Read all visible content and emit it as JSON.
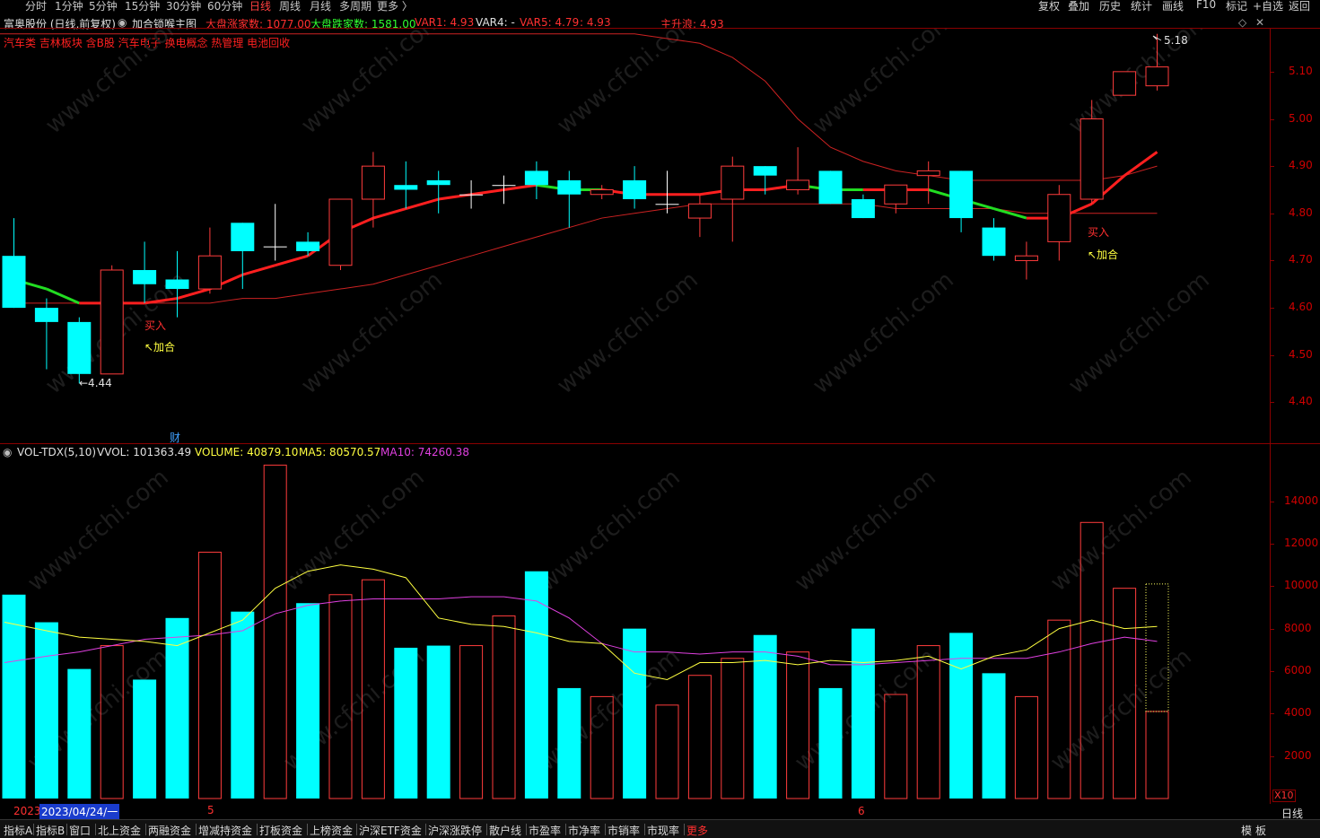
{
  "periods": [
    "分时",
    "1分钟",
    "5分钟",
    "15分钟",
    "30分钟",
    "60分钟",
    "日线",
    "周线",
    "月线",
    "多周期",
    "更多 〉"
  ],
  "active_period": "日线",
  "tools": [
    "复权",
    "叠加",
    "历史",
    "统计",
    "画线",
    "F10",
    "标记",
    "+自选",
    "返回"
  ],
  "stock_title": "富奥股份 (日线,前复权)",
  "indicator_name": "加合锁喉主图",
  "market_up": "大盘涨家数: 1077.00",
  "market_down": "大盘跌家数: 1581.00",
  "var1": "VAR1: 4.93",
  "var4": "VAR4: -",
  "var5": "VAR5: 4.79",
  "var_extra": ": 4.93",
  "main_rise": "主升浪: 4.93",
  "concepts": "汽车类 吉林板块 含B股 汽车电子 换电概念 热管理 电池回收",
  "price_ticks": [
    "5.10",
    "5.00",
    "4.90",
    "4.80",
    "4.70",
    "4.60",
    "4.50",
    "4.40"
  ],
  "vol_ticks": [
    "14000",
    "12000",
    "10000",
    "8000",
    "6000",
    "4000",
    "2000"
  ],
  "vol_indicator": {
    "name": "VOL-TDX(5,10)",
    "vvol": "VVOL: 101363.49",
    "volume": "VOLUME: 40879.10",
    "ma5": "MA5: 80570.57",
    "ma10": "MA10: 74260.38"
  },
  "vol_unit_label": "X10",
  "annotations": {
    "buy": "买入",
    "add": "↖加合",
    "low_price": "←4.44",
    "high_price": "5.18",
    "finance_mark": "财"
  },
  "date_labels": {
    "year": "2023",
    "current": "2023/04/24/一",
    "m5": "5",
    "m6": "6"
  },
  "bottom_tabs": [
    "指标A",
    "指标B",
    "窗口",
    "北上资金",
    "两融资金",
    "增减持资金",
    "打板资金",
    "上榜资金",
    "沪深ETF资金",
    "沪深涨跌停",
    "散户线",
    "市盈率",
    "市净率",
    "市销率",
    "市现率",
    "更多"
  ],
  "active_tab": "更多",
  "right_bottom": [
    "模",
    "板",
    "日线"
  ],
  "colors": {
    "up": "#ff3c3c",
    "down": "#00ffff",
    "flat": "#ffffff",
    "frame": "#8b0000",
    "ma_red": "#ff1f1f",
    "ma_green": "#22dd22",
    "ma_slow": "#cc2222",
    "vol_ma5": "#ffff40",
    "vol_ma10": "#e040e0",
    "buy_text": "#ff3030",
    "add_text": "#ffff40"
  },
  "chart_data": [
    {
      "type": "candlestick",
      "title": "富奥股份 (日线,前复权)",
      "ylim": [
        4.32,
        5.2
      ],
      "yticks": [
        4.4,
        4.5,
        4.6,
        4.7,
        4.8,
        4.9,
        5.0,
        5.1
      ],
      "candles": [
        {
          "o": 4.71,
          "h": 4.79,
          "l": 4.6,
          "c": 4.6
        },
        {
          "o": 4.6,
          "h": 4.62,
          "l": 4.47,
          "c": 4.57
        },
        {
          "o": 4.57,
          "h": 4.58,
          "l": 4.44,
          "c": 4.46
        },
        {
          "o": 4.46,
          "h": 4.69,
          "l": 4.46,
          "c": 4.68
        },
        {
          "o": 4.68,
          "h": 4.74,
          "l": 4.61,
          "c": 4.65
        },
        {
          "o": 4.66,
          "h": 4.72,
          "l": 4.58,
          "c": 4.64
        },
        {
          "o": 4.64,
          "h": 4.77,
          "l": 4.63,
          "c": 4.71
        },
        {
          "o": 4.78,
          "h": 4.78,
          "l": 4.64,
          "c": 4.72
        },
        {
          "o": 4.73,
          "h": 4.82,
          "l": 4.7,
          "c": 4.73
        },
        {
          "o": 4.74,
          "h": 4.76,
          "l": 4.71,
          "c": 4.72
        },
        {
          "o": 4.69,
          "h": 4.77,
          "l": 4.68,
          "c": 4.83
        },
        {
          "o": 4.83,
          "h": 4.93,
          "l": 4.77,
          "c": 4.9
        },
        {
          "o": 4.86,
          "h": 4.91,
          "l": 4.81,
          "c": 4.85
        },
        {
          "o": 4.87,
          "h": 4.89,
          "l": 4.8,
          "c": 4.86
        },
        {
          "o": 4.84,
          "h": 4.87,
          "l": 4.81,
          "c": 4.84
        },
        {
          "o": 4.86,
          "h": 4.88,
          "l": 4.82,
          "c": 4.86
        },
        {
          "o": 4.89,
          "h": 4.91,
          "l": 4.83,
          "c": 4.86
        },
        {
          "o": 4.87,
          "h": 4.89,
          "l": 4.77,
          "c": 4.84
        },
        {
          "o": 4.84,
          "h": 4.86,
          "l": 4.83,
          "c": 4.85
        },
        {
          "o": 4.87,
          "h": 4.9,
          "l": 4.81,
          "c": 4.83
        },
        {
          "o": 4.82,
          "h": 4.89,
          "l": 4.8,
          "c": 4.82
        },
        {
          "o": 4.79,
          "h": 4.84,
          "l": 4.75,
          "c": 4.82
        },
        {
          "o": 4.83,
          "h": 4.92,
          "l": 4.74,
          "c": 4.9
        },
        {
          "o": 4.9,
          "h": 4.9,
          "l": 4.84,
          "c": 4.88
        },
        {
          "o": 4.85,
          "h": 4.94,
          "l": 4.84,
          "c": 4.87
        },
        {
          "o": 4.89,
          "h": 4.89,
          "l": 4.82,
          "c": 4.82
        },
        {
          "o": 4.83,
          "h": 4.84,
          "l": 4.79,
          "c": 4.79
        },
        {
          "o": 4.82,
          "h": 4.85,
          "l": 4.8,
          "c": 4.86
        },
        {
          "o": 4.88,
          "h": 4.91,
          "l": 4.82,
          "c": 4.89
        },
        {
          "o": 4.89,
          "h": 4.89,
          "l": 4.76,
          "c": 4.79
        },
        {
          "o": 4.77,
          "h": 4.79,
          "l": 4.7,
          "c": 4.71
        },
        {
          "o": 4.7,
          "h": 4.74,
          "l": 4.66,
          "c": 4.71
        },
        {
          "o": 4.74,
          "h": 4.86,
          "l": 4.7,
          "c": 4.84
        },
        {
          "o": 4.83,
          "h": 5.04,
          "l": 4.82,
          "c": 5.0
        },
        {
          "o": 5.05,
          "h": 5.1,
          "l": 5.05,
          "c": 5.1
        },
        {
          "o": 5.07,
          "h": 5.18,
          "l": 5.06,
          "c": 5.11
        }
      ],
      "fast_ma": [
        4.66,
        4.64,
        4.61,
        4.61,
        4.61,
        4.62,
        4.64,
        4.67,
        4.69,
        4.71,
        4.76,
        4.79,
        4.81,
        4.83,
        4.84,
        4.85,
        4.86,
        4.85,
        4.85,
        4.84,
        4.84,
        4.84,
        4.85,
        4.85,
        4.86,
        4.85,
        4.85,
        4.85,
        4.85,
        4.83,
        4.81,
        4.79,
        4.79,
        4.82,
        4.88,
        4.93
      ],
      "fast_ma_color": [
        "green",
        "green",
        "green",
        "red",
        "red",
        "red",
        "red",
        "red",
        "red",
        "red",
        "red",
        "red",
        "red",
        "red",
        "red",
        "red",
        "red",
        "green",
        "green",
        "red",
        "red",
        "red",
        "red",
        "red",
        "red",
        "green",
        "green",
        "red",
        "red",
        "green",
        "green",
        "green",
        "red",
        "red",
        "red",
        "red"
      ],
      "slow_ma": [
        4.61,
        4.61,
        4.61,
        4.61,
        4.61,
        4.61,
        4.61,
        4.62,
        4.62,
        4.63,
        4.64,
        4.65,
        4.67,
        4.69,
        4.71,
        4.73,
        4.75,
        4.77,
        4.79,
        4.8,
        4.81,
        4.82,
        4.82,
        4.82,
        4.82,
        4.82,
        4.82,
        4.81,
        4.81,
        4.81,
        4.81,
        4.8,
        4.8,
        4.8,
        4.8,
        4.8
      ],
      "var_curve": [
        5.18,
        5.18,
        5.18,
        5.18,
        5.18,
        5.18,
        5.18,
        5.18,
        5.18,
        5.18,
        5.18,
        5.18,
        5.18,
        5.18,
        5.18,
        5.18,
        5.18,
        5.18,
        5.18,
        5.18,
        5.17,
        5.16,
        5.13,
        5.08,
        5.0,
        4.94,
        4.91,
        4.89,
        4.88,
        4.87,
        4.87,
        4.87,
        4.87,
        4.87,
        4.88,
        4.9
      ]
    },
    {
      "type": "bar",
      "title": "VOL-TDX(5,10)",
      "unit": "X10",
      "ylim": [
        0,
        16000
      ],
      "yticks": [
        2000,
        4000,
        6000,
        8000,
        10000,
        12000,
        14000
      ],
      "volume": [
        9600,
        8300,
        6100,
        7200,
        5600,
        8500,
        11600,
        8800,
        15700,
        9200,
        9600,
        10300,
        7100,
        7200,
        7200,
        8600,
        10700,
        5200,
        4800,
        8000,
        4400,
        5800,
        6600,
        7700,
        6900,
        5200,
        8000,
        4900,
        7200,
        7800,
        5900,
        4800,
        8400,
        13000,
        9900,
        4100
      ],
      "volume_dotted_last": 10100,
      "ma5": [
        8300,
        7900,
        7600,
        7500,
        7400,
        7200,
        7800,
        8400,
        9900,
        10700,
        11000,
        10800,
        10400,
        8500,
        8200,
        8100,
        7800,
        7400,
        7300,
        5900,
        5600,
        6400,
        6400,
        6500,
        6300,
        6500,
        6400,
        6500,
        6700,
        6100,
        6700,
        7000,
        8000,
        8400,
        8000,
        8100
      ],
      "ma10": [
        6400,
        6700,
        6900,
        7200,
        7500,
        7600,
        7700,
        7900,
        8700,
        9100,
        9300,
        9400,
        9400,
        9400,
        9500,
        9500,
        9300,
        8500,
        7300,
        6900,
        6900,
        6800,
        6900,
        6900,
        6700,
        6300,
        6300,
        6400,
        6500,
        6600,
        6600,
        6600,
        6900,
        7300,
        7600,
        7400
      ]
    }
  ]
}
